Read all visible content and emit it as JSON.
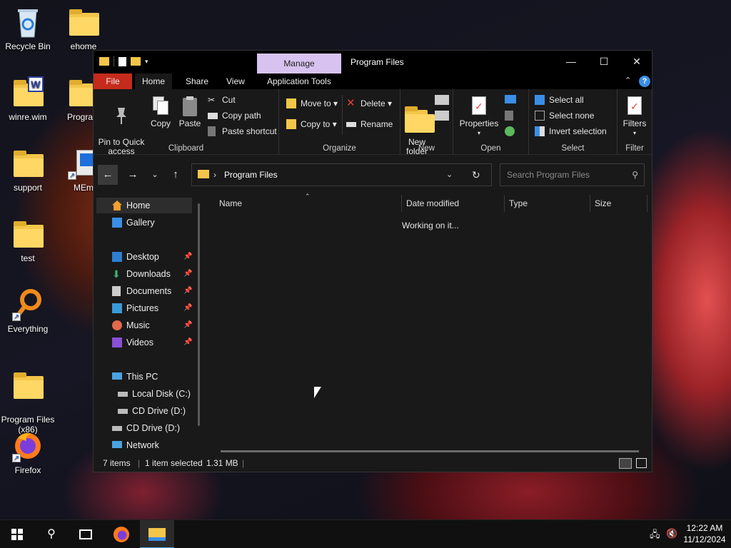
{
  "desktop": {
    "icons": [
      {
        "label": "Recycle Bin",
        "icon": "recycle-bin-icon"
      },
      {
        "label": "ehome",
        "icon": "folder-icon"
      },
      {
        "label": "winre.wim",
        "icon": "wim-file-icon"
      },
      {
        "label": "Program",
        "icon": "folder-icon"
      },
      {
        "label": "support",
        "icon": "folder-icon"
      },
      {
        "label": "MEm",
        "icon": "app-shortcut-icon"
      },
      {
        "label": "test",
        "icon": "folder-icon"
      },
      {
        "label": "Everything",
        "icon": "search-app-icon"
      },
      {
        "label": "Program Files\n(x86)",
        "icon": "folder-icon"
      },
      {
        "label": "Firefox",
        "icon": "firefox-icon"
      }
    ]
  },
  "window": {
    "title": "Program Files",
    "manage_tab": "Manage",
    "controls": {
      "minimize": "—",
      "maximize": "☐",
      "close": "✕"
    },
    "tabs": [
      "File",
      "Home",
      "Share",
      "View",
      "Application Tools"
    ],
    "ribbon": {
      "clipboard": {
        "group": "Clipboard",
        "pin": "Pin to Quick\naccess",
        "copy": "Copy",
        "paste": "Paste",
        "cut": "Cut",
        "copy_path": "Copy path",
        "paste_shortcut": "Paste shortcut"
      },
      "organize": {
        "group": "Organize",
        "move_to": "Move to",
        "copy_to": "Copy to",
        "delete": "Delete",
        "rename": "Rename"
      },
      "new": {
        "group": "New",
        "new_folder": "New\nfolder"
      },
      "open": {
        "group": "Open",
        "properties": "Properties"
      },
      "select": {
        "group": "Select",
        "select_all": "Select all",
        "select_none": "Select none",
        "invert": "Invert selection"
      },
      "filter": {
        "group": "Filter",
        "filters": "Filters"
      }
    },
    "address": {
      "path": "Program Files",
      "separator": "›"
    },
    "search": {
      "placeholder": "Search Program Files"
    },
    "nav_pane": {
      "home": "Home",
      "gallery": "Gallery",
      "desktop": "Desktop",
      "downloads": "Downloads",
      "documents": "Documents",
      "pictures": "Pictures",
      "music": "Music",
      "videos": "Videos",
      "this_pc": "This PC",
      "local_disk": "Local Disk (C:)",
      "cd_drive_1": "CD Drive (D:)",
      "cd_drive_2": "CD Drive (D:)",
      "network": "Network"
    },
    "columns": [
      "Name",
      "Date modified",
      "Type",
      "Size"
    ],
    "loading_text": "Working on it...",
    "status": {
      "items": "7 items",
      "selected": "1 item selected",
      "size": "1.31 MB"
    }
  },
  "taskbar": {
    "time": "12:22 AM",
    "date": "11/12/2024"
  },
  "colors": {
    "accent_red": "#c42b1c",
    "manage_tab": "#d8c3f0",
    "folder": "#f3c64a",
    "link_blue": "#3a8ee6"
  }
}
